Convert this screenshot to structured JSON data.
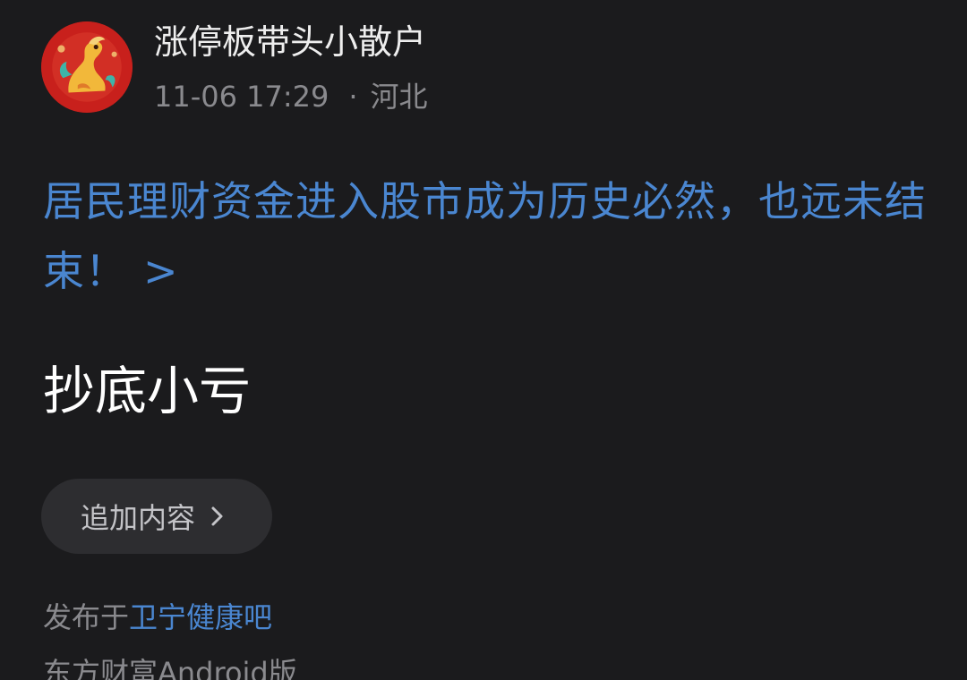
{
  "author": {
    "avatar_icon": "dragon-avatar-icon",
    "name": "涨停板带头小散户",
    "timestamp": "11-06 17:29",
    "separator": "·",
    "location": "河北"
  },
  "post": {
    "title_link": "居民理财资金进入股市成为历史必然，也远未结束！",
    "title_chevron": ">",
    "body": "抄底小亏"
  },
  "actions": {
    "add_content_label": "追加内容"
  },
  "footer": {
    "publish_prefix": "发布于",
    "forum_name": "卫宁健康吧",
    "source": "东方财富Android版"
  },
  "colors": {
    "background": "#1b1b1d",
    "link": "#4a86d0",
    "muted": "#8a8a8e",
    "button_bg": "#2d2d30"
  }
}
